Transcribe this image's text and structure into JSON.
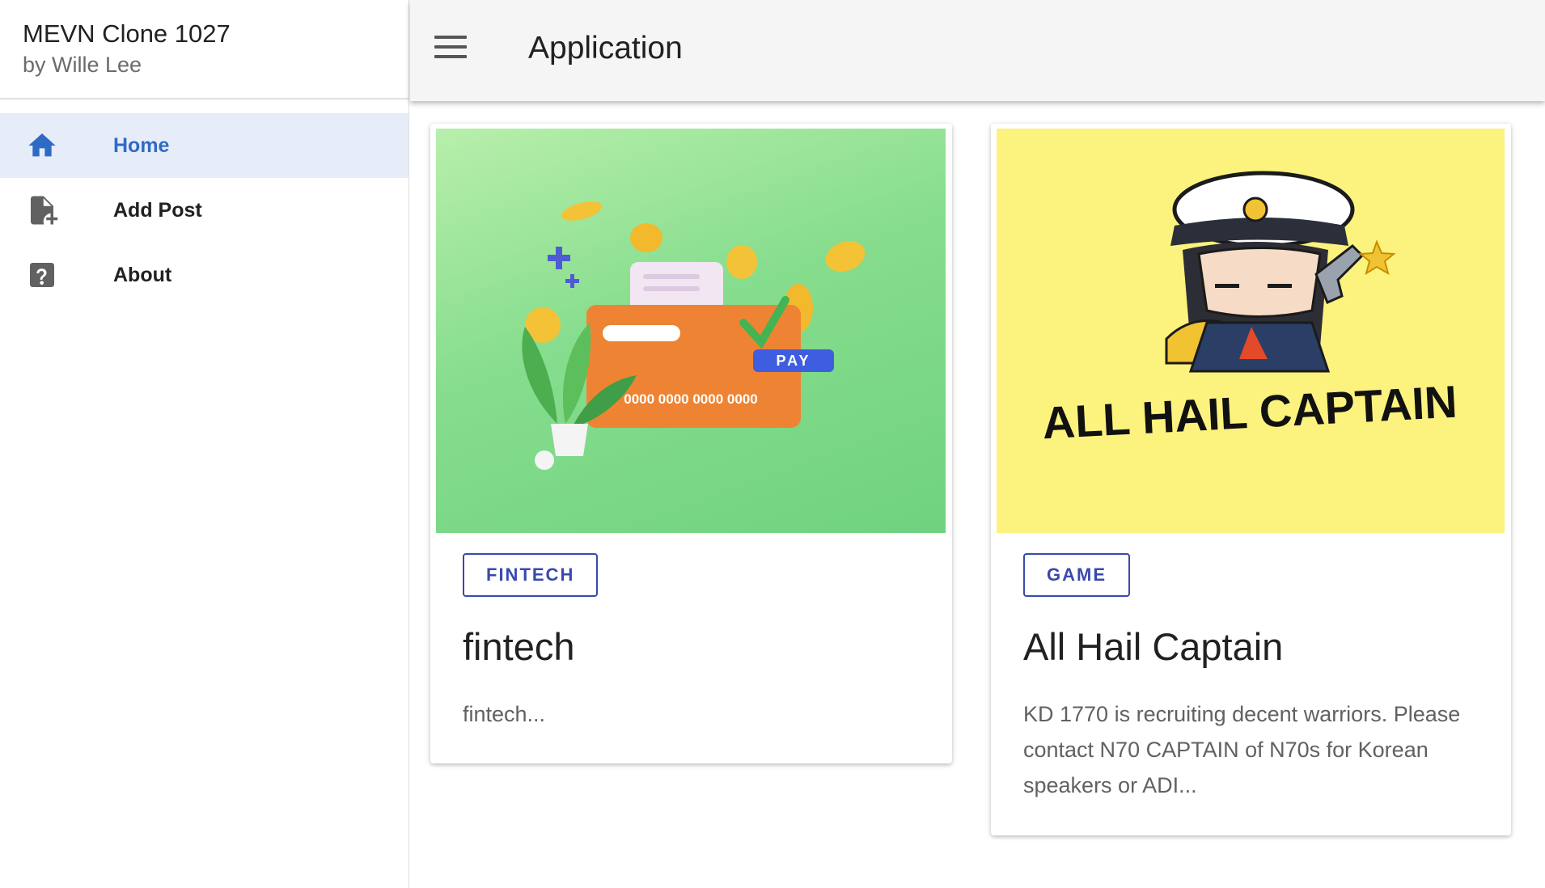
{
  "sidebar": {
    "app_title": "MEVN Clone 1027",
    "author": "by Wille Lee",
    "items": [
      {
        "label": "Home",
        "icon": "home-icon",
        "active": true
      },
      {
        "label": "Add Post",
        "icon": "file-plus-icon",
        "active": false
      },
      {
        "label": "About",
        "icon": "help-box-icon",
        "active": false
      }
    ]
  },
  "header": {
    "title": "Application",
    "menu_icon": "hamburger-menu-icon"
  },
  "posts": [
    {
      "category": "FINTECH",
      "title": "fintech",
      "excerpt": "fintech...",
      "image": {
        "card_number": "0000 0000 0000 0000",
        "pay_label": "PAY"
      }
    },
    {
      "category": "GAME",
      "title": "All Hail Captain",
      "excerpt": "KD 1770 is recruiting decent warriors. Please contact N70 CAPTAIN of N70s for Korean speakers or ADI...",
      "image": {
        "logo_text": "ALL HAIL CAPTAIN"
      }
    }
  ],
  "colors": {
    "accent": "#2f6bc4",
    "chip": "#3949ab",
    "active_nav_bg": "#e6edf9",
    "header_bg": "#f5f5f5",
    "fintech_bg": "#86dd8d",
    "game_bg": "#fcf27e"
  }
}
